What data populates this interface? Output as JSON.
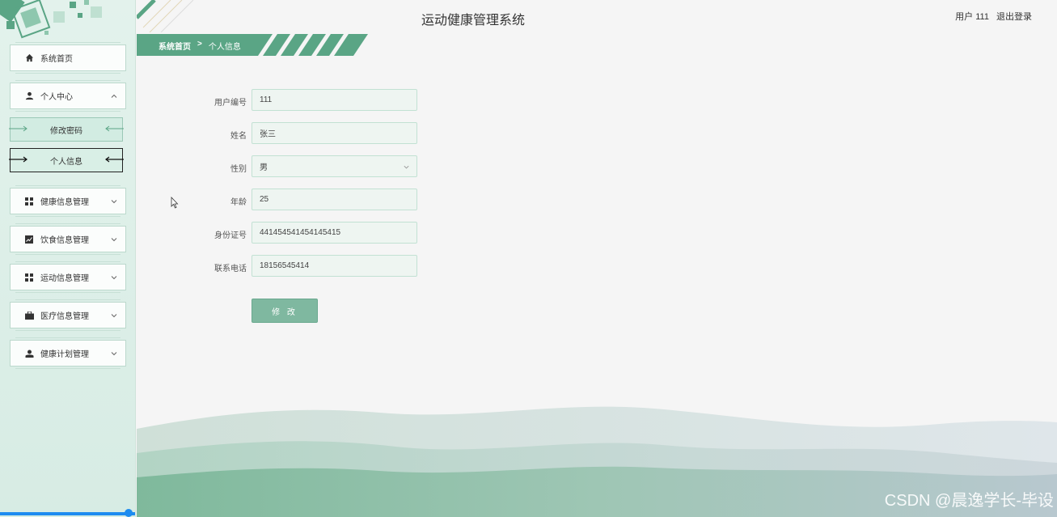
{
  "header": {
    "title": "运动健康管理系统",
    "user_label": "用户 111",
    "logout_label": "退出登录"
  },
  "breadcrumb": {
    "home": "系统首页",
    "separator": ">",
    "current": "个人信息"
  },
  "sidebar": {
    "home": "系统首页",
    "personal_center": "个人中心",
    "sub_items": [
      "修改密码",
      "个人信息"
    ],
    "health_info": "健康信息管理",
    "diet_info": "饮食信息管理",
    "exercise_info": "运动信息管理",
    "medical_info": "医疗信息管理",
    "health_plan": "健康计划管理"
  },
  "form": {
    "fields": [
      {
        "label": "用户编号",
        "value": "111"
      },
      {
        "label": "姓名",
        "value": "张三"
      },
      {
        "label": "性别",
        "value": "男"
      },
      {
        "label": "年龄",
        "value": "25"
      },
      {
        "label": "身份证号",
        "value": "441454541454145415"
      },
      {
        "label": "联系电话",
        "value": "18156545414"
      }
    ],
    "submit_label": "修 改"
  },
  "watermark": "CSDN @晨逸学长-毕设",
  "colors": {
    "accent": "#5aa585",
    "sidebar_bg": "#dcefe7",
    "button": "#7fb8a0"
  }
}
